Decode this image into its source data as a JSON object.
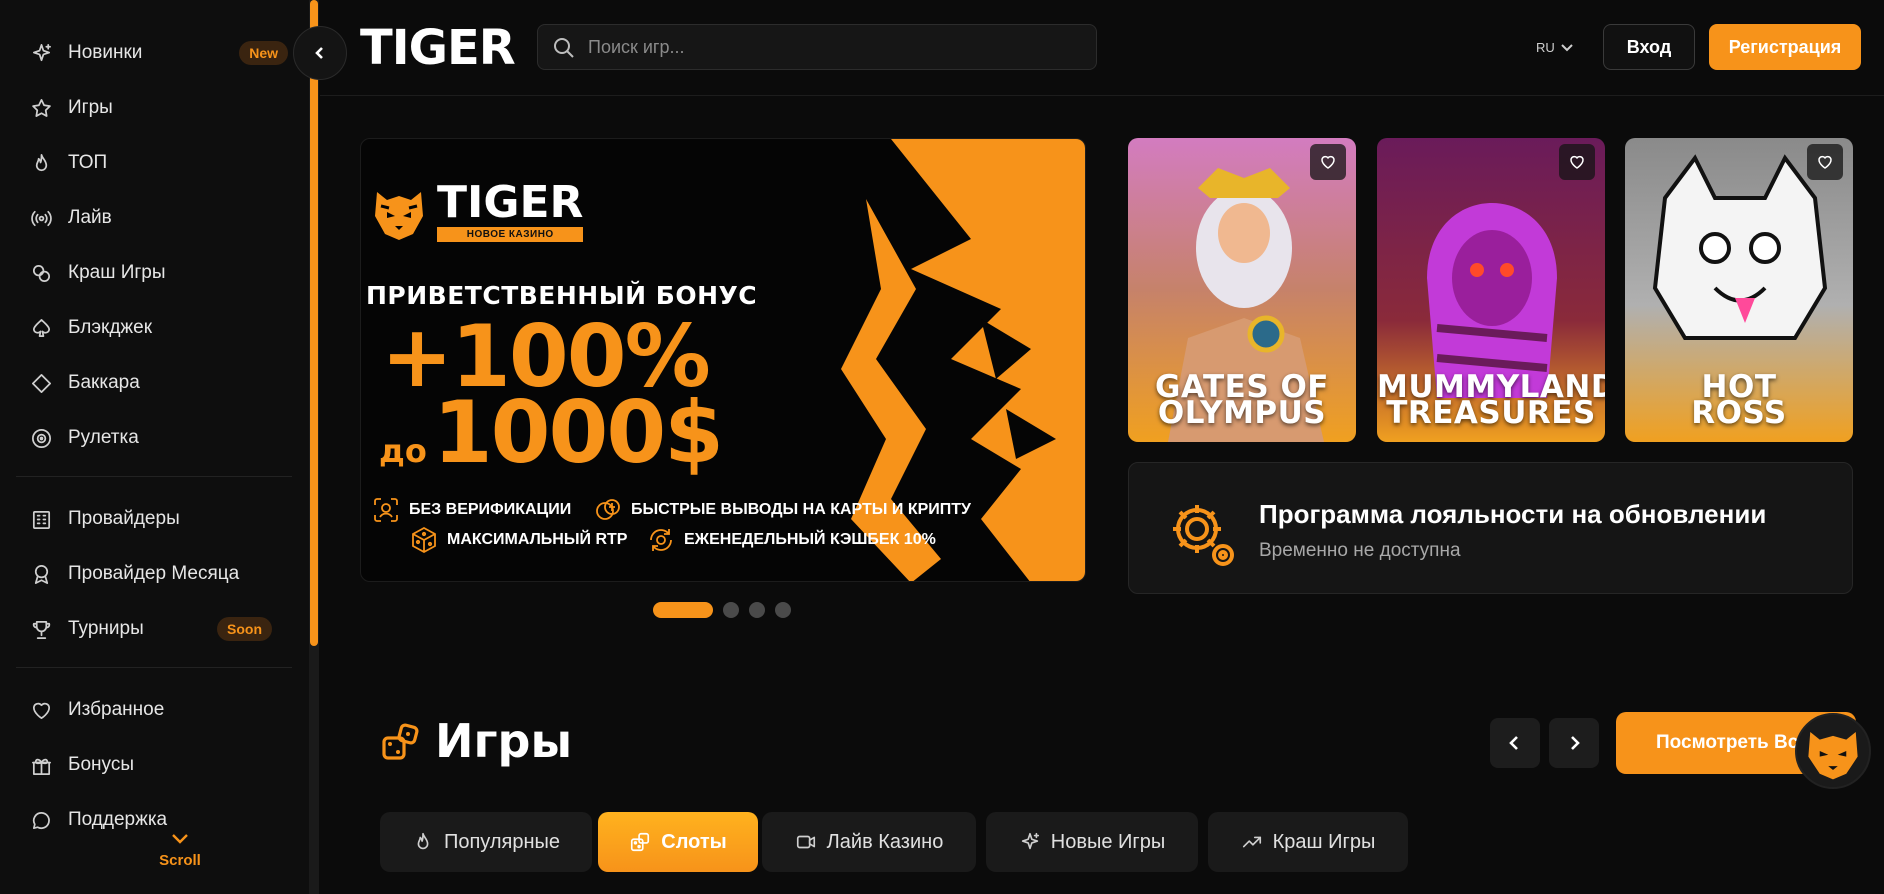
{
  "sidebar": {
    "items": [
      {
        "label": "Новинки",
        "icon": "sparkle-icon",
        "badge": "New"
      },
      {
        "label": "Игры",
        "icon": "star-icon"
      },
      {
        "label": "ТОП",
        "icon": "flame-icon"
      },
      {
        "label": "Лайв",
        "icon": "broadcast-icon"
      },
      {
        "label": "Краш Игры",
        "icon": "crash-icon"
      },
      {
        "label": "Блэкджек",
        "icon": "spade-icon"
      },
      {
        "label": "Баккара",
        "icon": "diamond-icon"
      },
      {
        "label": "Рулетка",
        "icon": "roulette-icon"
      },
      {
        "label": "Провайдеры",
        "icon": "building-icon"
      },
      {
        "label": "Провайдер Месяца",
        "icon": "medal-icon"
      },
      {
        "label": "Турниры",
        "icon": "trophy-icon",
        "badge": "Soon"
      },
      {
        "label": "Избранное",
        "icon": "heart-icon"
      },
      {
        "label": "Бонусы",
        "icon": "gift-icon"
      },
      {
        "label": "Поддержка",
        "icon": "chat-icon"
      }
    ],
    "scroll_label": "Scroll"
  },
  "header": {
    "logo": "TIGER",
    "search_placeholder": "Поиск игр...",
    "language": "RU",
    "login_label": "Вход",
    "register_label": "Регистрация"
  },
  "banner": {
    "logo_name": "TIGER",
    "logo_sub": "НОВОЕ КАЗИНО",
    "title": "ПРИВЕТСТВЕННЫЙ БОНУС",
    "percent": "+100%",
    "amount_prefix": "до",
    "amount": "1000$",
    "features": [
      {
        "text": "БЕЗ ВЕРИФИКАЦИИ",
        "icon": "face-id-icon"
      },
      {
        "text": "БЫСТРЫЕ ВЫВОДЫ НА КАРТЫ И КРИПТУ",
        "icon": "coins-icon"
      },
      {
        "text": "МАКСИМАЛЬНЫЙ RTP",
        "icon": "dice-icon"
      },
      {
        "text": "ЕЖЕНЕДЕЛЬНЫЙ КЭШБЕК 10%",
        "icon": "cashback-icon"
      }
    ],
    "slides": 4,
    "active_slide": 1
  },
  "featured_games": [
    {
      "title_line1": "GATES OF",
      "title_line2": "OLYMPUS"
    },
    {
      "title_line1": "MUMMYLAND",
      "title_line2": "TREASURES"
    },
    {
      "title_line1": "HOT",
      "title_line2": "ROSS"
    }
  ],
  "loyalty": {
    "title": "Программа лояльности на обновлении",
    "subtitle": "Временно не доступна"
  },
  "games_section": {
    "title": "Игры",
    "view_all_label": "Посмотреть Все",
    "tabs": [
      {
        "label": "Популярные",
        "icon": "flame-icon"
      },
      {
        "label": "Слоты",
        "icon": "dice-icon",
        "active": true
      },
      {
        "label": "Лайв Казино",
        "icon": "video-icon"
      },
      {
        "label": "Новые Игры",
        "icon": "sparkle-icon"
      },
      {
        "label": "Краш Игры",
        "icon": "trend-icon"
      }
    ]
  },
  "colors": {
    "accent": "#f7931a",
    "background": "#0b0b0b",
    "card": "#151515"
  }
}
